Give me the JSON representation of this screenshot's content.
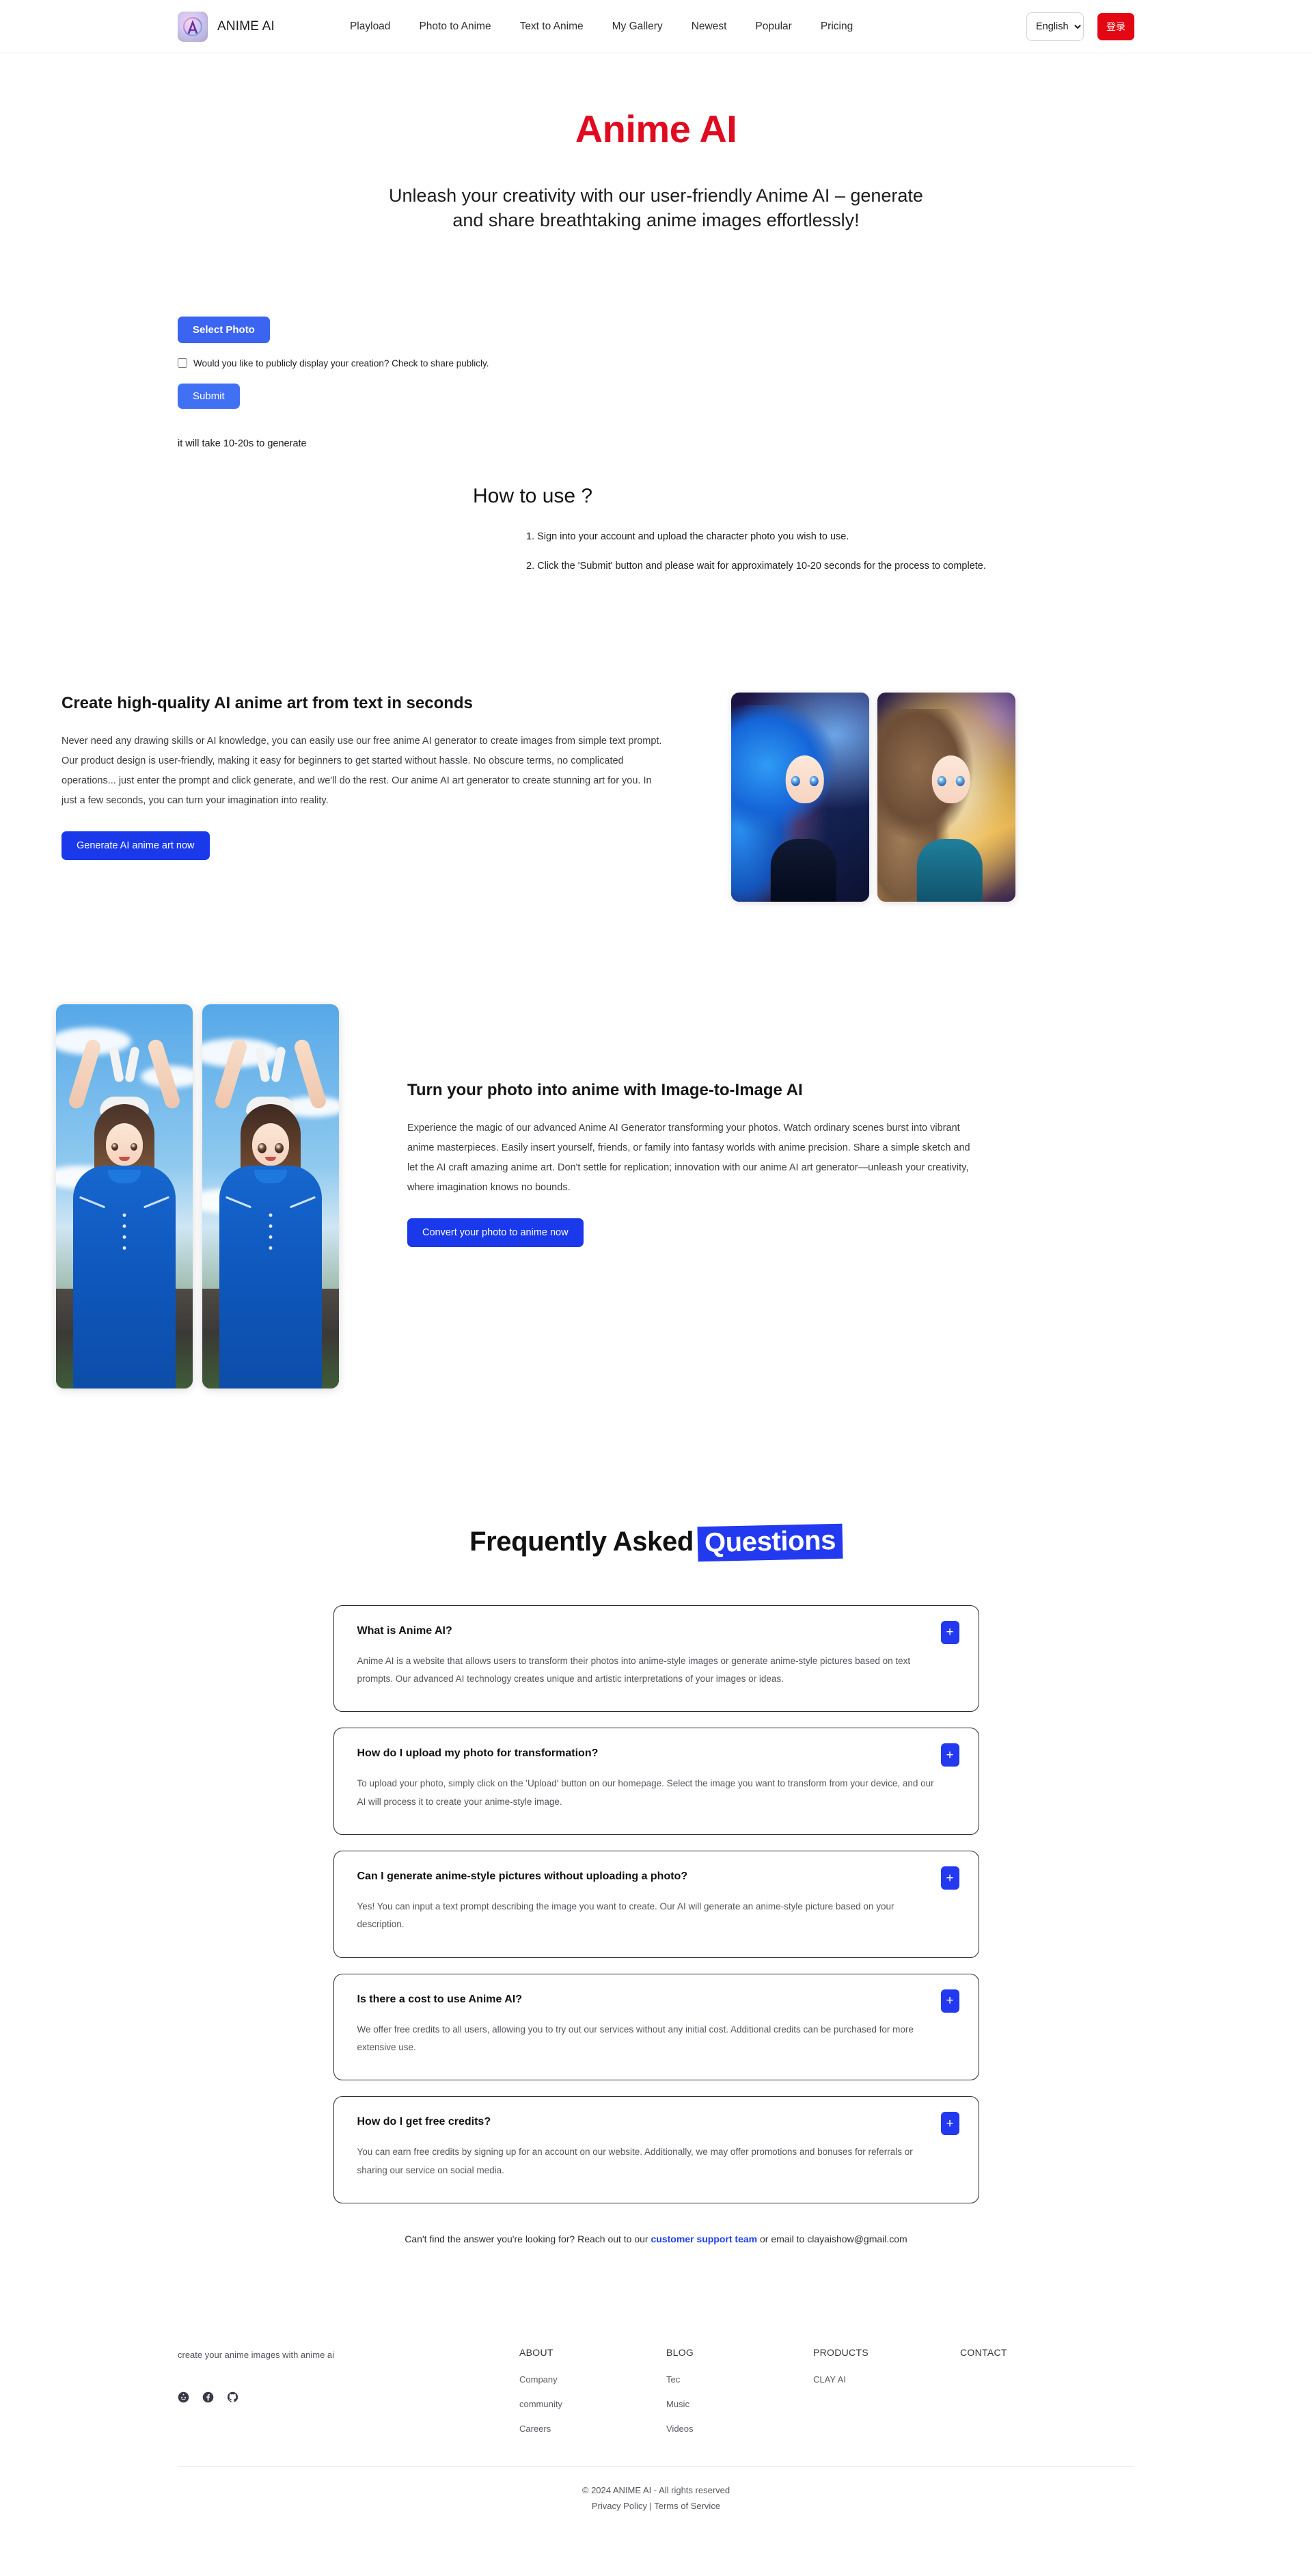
{
  "header": {
    "brand_name": "ANIME AI",
    "logo_letter": "A",
    "nav": [
      {
        "label": "Playload"
      },
      {
        "label": "Photo to Anime"
      },
      {
        "label": "Text to Anime"
      },
      {
        "label": "My Gallery"
      },
      {
        "label": "Newest"
      },
      {
        "label": "Popular"
      },
      {
        "label": "Pricing"
      }
    ],
    "language": {
      "selected": "English",
      "options": [
        "English"
      ]
    },
    "login_label": "登录"
  },
  "hero": {
    "title": "Anime AI",
    "subtitle": "Unleash your creativity with our user-friendly Anime AI – generate and share breathtaking anime images effortlessly!"
  },
  "upload": {
    "select_photo_label": "Select Photo",
    "share_checkbox_label": "Would you like to publicly display your creation? Check to share publicly.",
    "share_checked": false,
    "submit_label": "Submit",
    "generate_note": "it will take 10-20s to generate"
  },
  "howto": {
    "title": "How to use ?",
    "steps": [
      "1. Sign into your account and upload the character photo you wish to use.",
      "2. Click the 'Submit' button and please wait for approximately 10-20 seconds for the process to complete."
    ]
  },
  "feature_text_to_anime": {
    "heading": "Create high-quality AI anime art from text in seconds",
    "body": "Never need any drawing skills or AI knowledge, you can easily use our free anime AI generator to create images from simple text prompt. Our product design is user-friendly, making it easy for beginners to get started without hassle. No obscure terms, no complicated operations... just enter the prompt and click generate, and we'll do the rest. Our anime AI art generator to create stunning art for you. In just a few seconds, you can turn your imagination into reality.",
    "cta_label": "Generate AI anime art now",
    "image_alts": [
      "anime girl with blue hair cosmic background",
      "anime girl with brown hair golden background"
    ]
  },
  "feature_image_to_image": {
    "heading": "Turn your photo into anime with Image-to-Image AI",
    "body": "Experience the magic of our advanced Anime AI Generator transforming your photos. Watch ordinary scenes burst into vibrant anime masterpieces. Easily insert yourself, friends, or family into fantasy worlds with anime precision. Share a simple sketch and let the AI craft amazing anime art. Don't settle for replication; innovation with our anime AI art generator—unleash your creativity, where imagination knows no bounds.",
    "cta_label": "Convert your photo to anime now",
    "image_alts": [
      "original photo of girl in blue dress with bunny ears",
      "anime converted version of girl in blue dress"
    ]
  },
  "faq": {
    "title_plain": "Frequently Asked",
    "title_highlight": "Questions",
    "toggle_icon": "+",
    "items": [
      {
        "question": "What is Anime AI?",
        "answer": "Anime AI is a website that allows users to transform their photos into anime-style images or generate anime-style pictures based on text prompts. Our advanced AI technology creates unique and artistic interpretations of your images or ideas."
      },
      {
        "question": "How do I upload my photo for transformation?",
        "answer": "To upload your photo, simply click on the 'Upload' button on our homepage. Select the image you want to transform from your device, and our AI will process it to create your anime-style image."
      },
      {
        "question": "Can I generate anime-style pictures without uploading a photo?",
        "answer": "Yes! You can input a text prompt describing the image you want to create. Our AI will generate an anime-style picture based on your description."
      },
      {
        "question": "Is there a cost to use Anime AI?",
        "answer": "We offer free credits to all users, allowing you to try out our services without any initial cost. Additional credits can be purchased for more extensive use."
      },
      {
        "question": "How do I get free credits?",
        "answer": "You can earn free credits by signing up for an account on our website. Additionally, we may offer promotions and bonuses for referrals or sharing our service on social media."
      }
    ],
    "contact_prefix": "Can't find the answer you're looking for? Reach out to our ",
    "contact_link": "customer support team",
    "contact_suffix": " or email to clayaishow@gmail.com"
  },
  "footer": {
    "tagline": "create your anime images with anime ai",
    "socials": [
      "reddit-icon",
      "facebook-icon",
      "github-icon"
    ],
    "columns": [
      {
        "head": "ABOUT",
        "links": [
          "Company",
          "community",
          "Careers"
        ]
      },
      {
        "head": "BLOG",
        "links": [
          "Tec",
          "Music",
          "Videos"
        ]
      },
      {
        "head": "PRODUCTS",
        "links": [
          "CLAY AI"
        ]
      },
      {
        "head": "CONTACT",
        "links": []
      }
    ],
    "copyright": "© 2024 ANIME AI - All rights reserved",
    "privacy_label": "Privacy Policy",
    "separator": "|",
    "terms_label": "Terms of Service"
  },
  "colors": {
    "brand_red": "#e00b1f",
    "login_red": "#e30613",
    "primary_blue": "#3b64f0",
    "deep_blue": "#1939eb",
    "highlight_blue": "#2239f0"
  }
}
